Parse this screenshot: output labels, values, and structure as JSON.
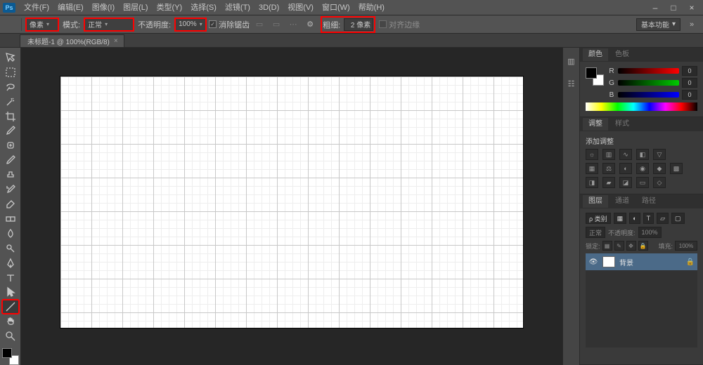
{
  "app_logo": "Ps",
  "menubar": {
    "items": [
      "文件(F)",
      "编辑(E)",
      "图像(I)",
      "图层(L)",
      "类型(Y)",
      "选择(S)",
      "滤镜(T)",
      "3D(D)",
      "视图(V)",
      "窗口(W)",
      "帮助(H)"
    ]
  },
  "window_controls": {
    "min": "–",
    "max": "□",
    "close": "×"
  },
  "optionsbar": {
    "size_value": "像素",
    "mode_label": "模式:",
    "mode_value": "正常",
    "opacity_label": "不透明度:",
    "opacity_value": "100%",
    "antialias_label": "消除锯齿",
    "weight_label": "粗细:",
    "weight_value": "2 像素",
    "align_label": "对齐边缘",
    "workspace_switcher": "基本功能"
  },
  "doc_tab": {
    "title": "未标题-1 @ 100%(RGB/8)",
    "close": "×"
  },
  "toolbox": {
    "tools": [
      "move-tool",
      "marquee-tool",
      "lasso-tool",
      "magic-wand-tool",
      "crop-tool",
      "eyedropper-tool",
      "spot-heal-tool",
      "brush-tool",
      "clone-stamp-tool",
      "history-brush-tool",
      "eraser-tool",
      "gradient-tool",
      "blur-tool",
      "dodge-tool",
      "pen-tool",
      "type-tool",
      "path-select-tool",
      "line-tool",
      "hand-tool",
      "zoom-tool"
    ],
    "highlighted_index": 17
  },
  "dock_strip": {
    "icons": [
      "history-icon",
      "properties-icon"
    ]
  },
  "color_panel": {
    "tabs": [
      "颜色",
      "色板"
    ],
    "channels": [
      {
        "label": "R",
        "value": "0"
      },
      {
        "label": "G",
        "value": "0"
      },
      {
        "label": "B",
        "value": "0"
      }
    ]
  },
  "adjustments_panel": {
    "tabs": [
      "调整",
      "样式"
    ],
    "title": "添加调整"
  },
  "layers_panel": {
    "tabs": [
      "图层",
      "通道",
      "路径"
    ],
    "kind_label": "ρ 类别",
    "blend_mode": "正常",
    "opacity_label": "不透明度:",
    "opacity_value": "100%",
    "lock_label": "锁定:",
    "fill_label": "填充:",
    "fill_value": "100%",
    "layer_name": "背景"
  },
  "chart_data": null
}
